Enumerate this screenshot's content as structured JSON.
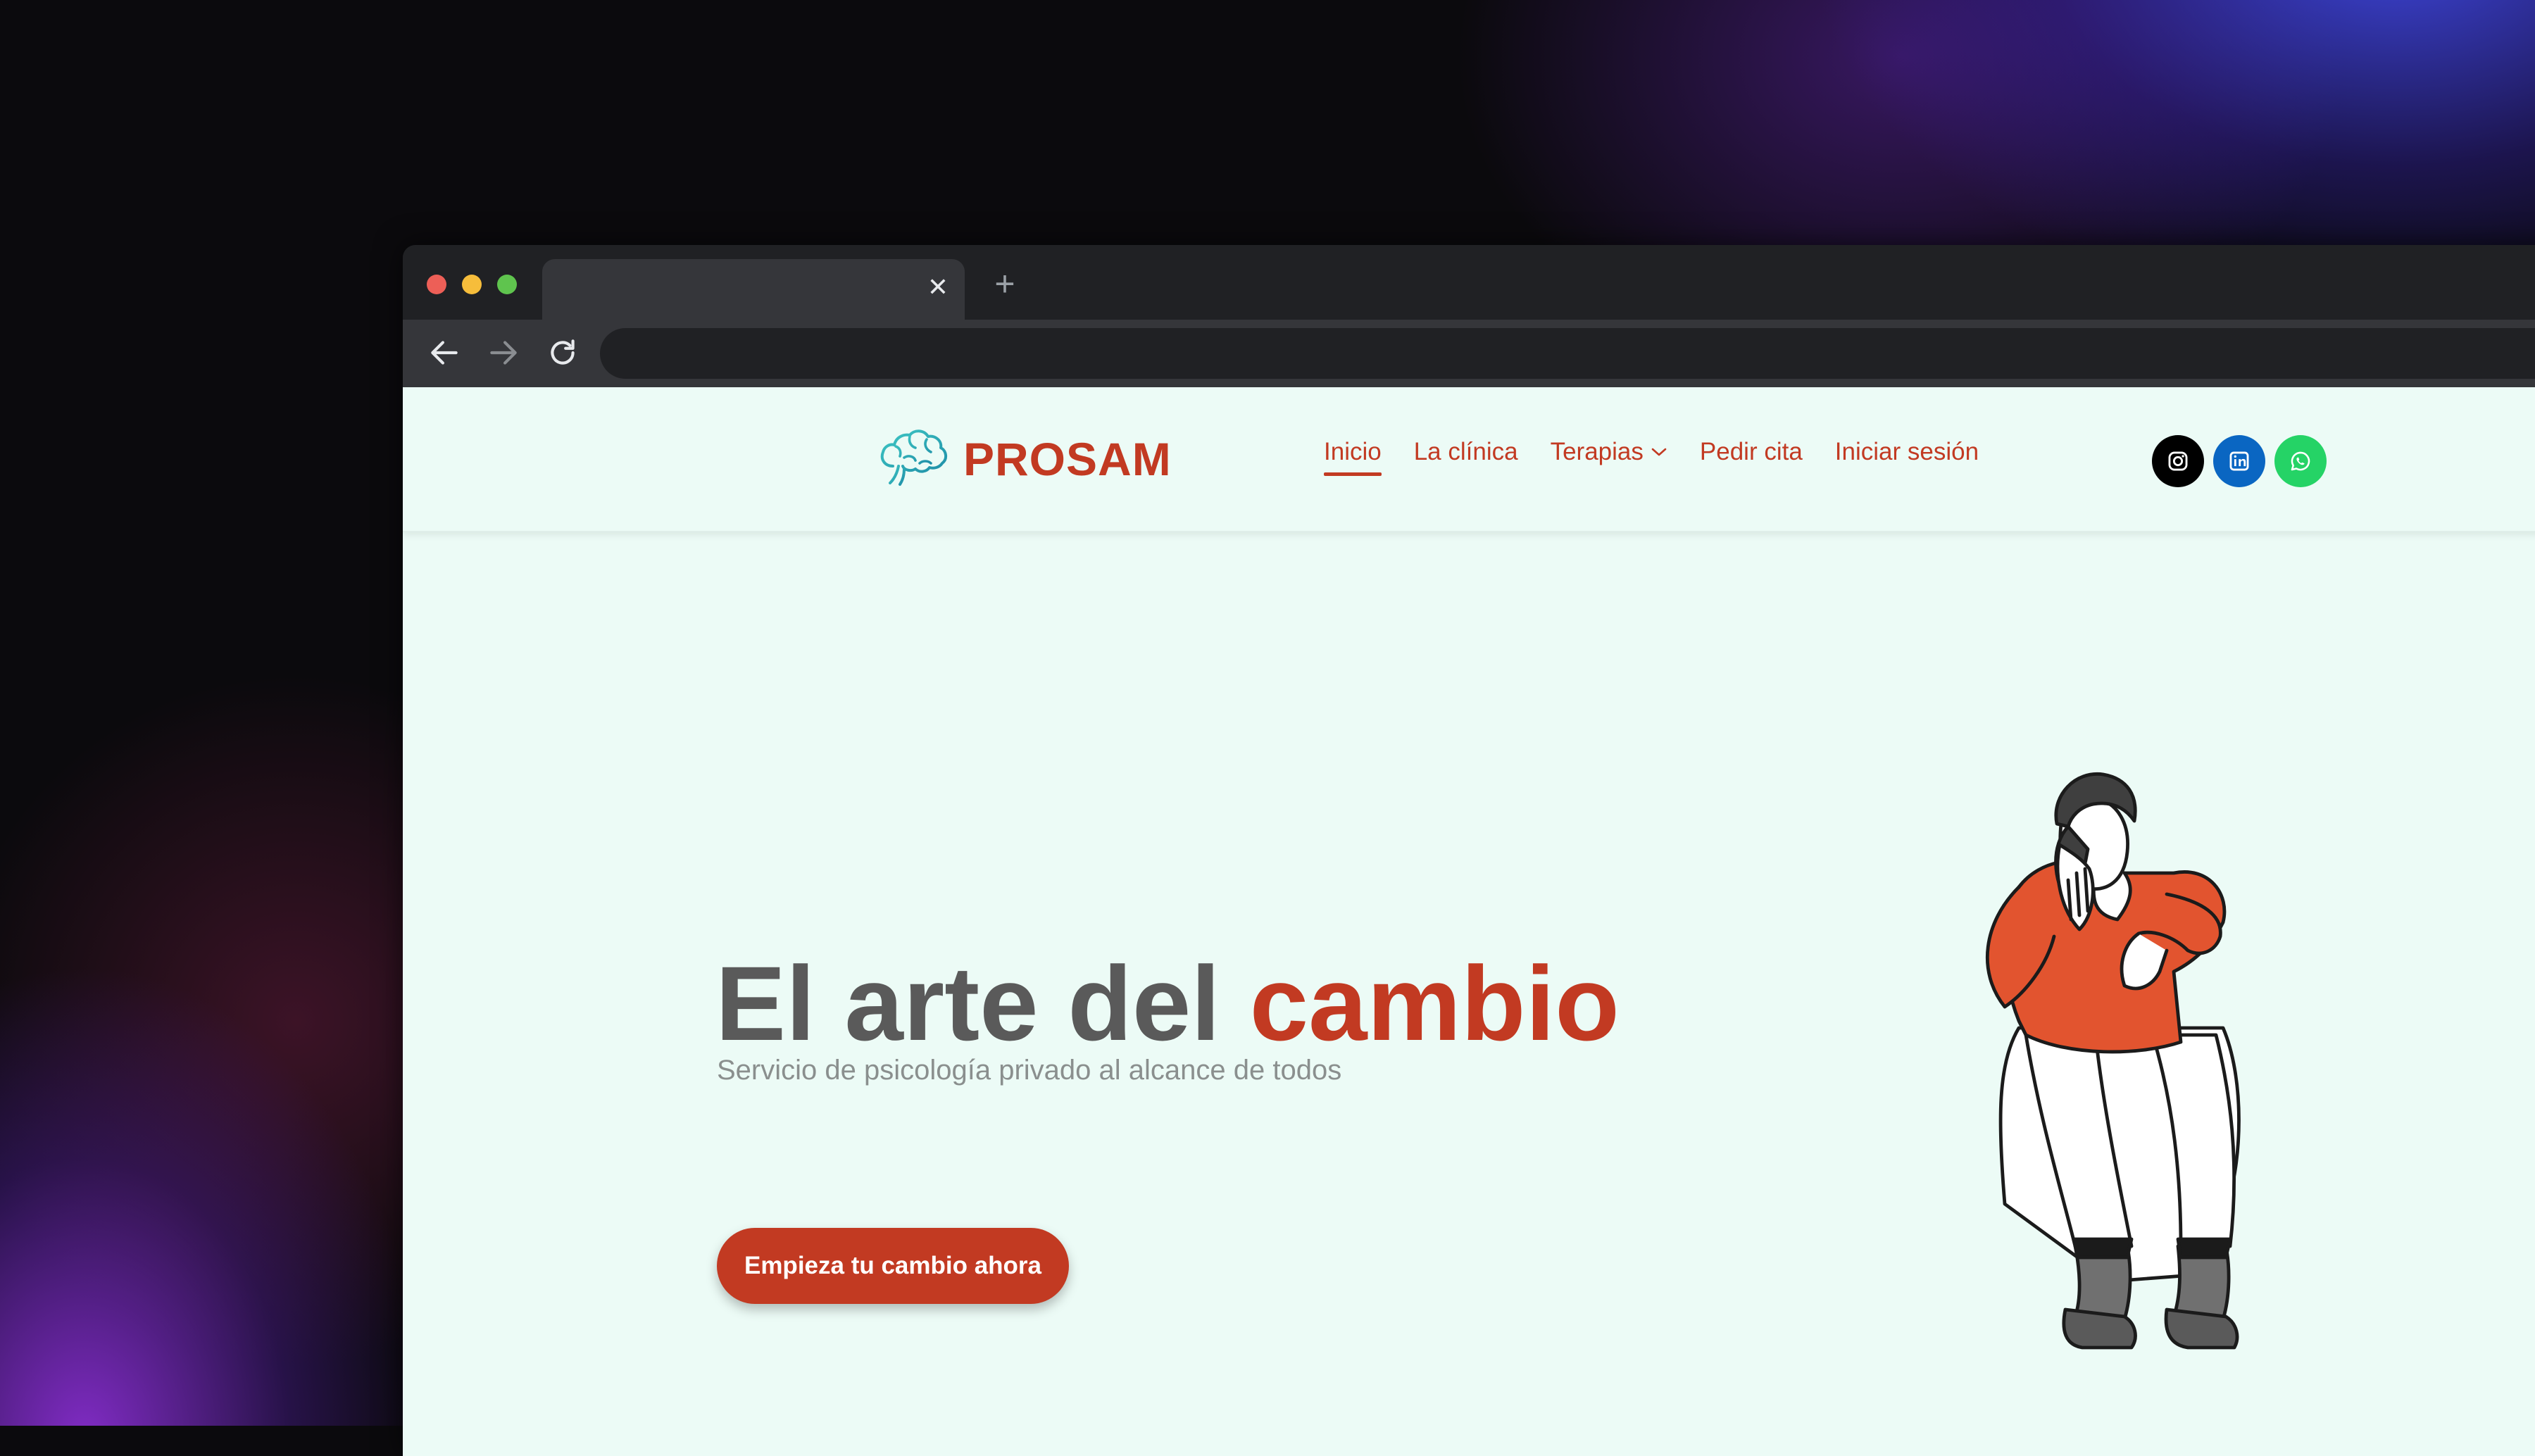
{
  "browser": {
    "tab_close_glyph": "✕",
    "new_tab_glyph": "+",
    "traffic_lights": [
      "#ed5f57",
      "#f6bd3b",
      "#5fc44e"
    ],
    "address": ""
  },
  "site": {
    "brand": "PROSAM",
    "brand_color": "#c23a22",
    "nav": [
      {
        "label": "Inicio",
        "active": true
      },
      {
        "label": "La clínica"
      },
      {
        "label": "Terapias",
        "has_dropdown": true
      },
      {
        "label": "Pedir cita"
      },
      {
        "label": "Iniciar sesión"
      }
    ],
    "social": [
      {
        "name": "instagram-icon",
        "color": "#000000"
      },
      {
        "name": "linkedin-icon",
        "color": "#0a66c2"
      },
      {
        "name": "whatsapp-icon",
        "color": "#25d366"
      }
    ]
  },
  "hero": {
    "title_part1": "El arte del ",
    "title_accent": "cambio",
    "subtitle": "Servicio de psicología privado al alcance de todos",
    "cta_label": "Empieza tu cambio ahora"
  }
}
